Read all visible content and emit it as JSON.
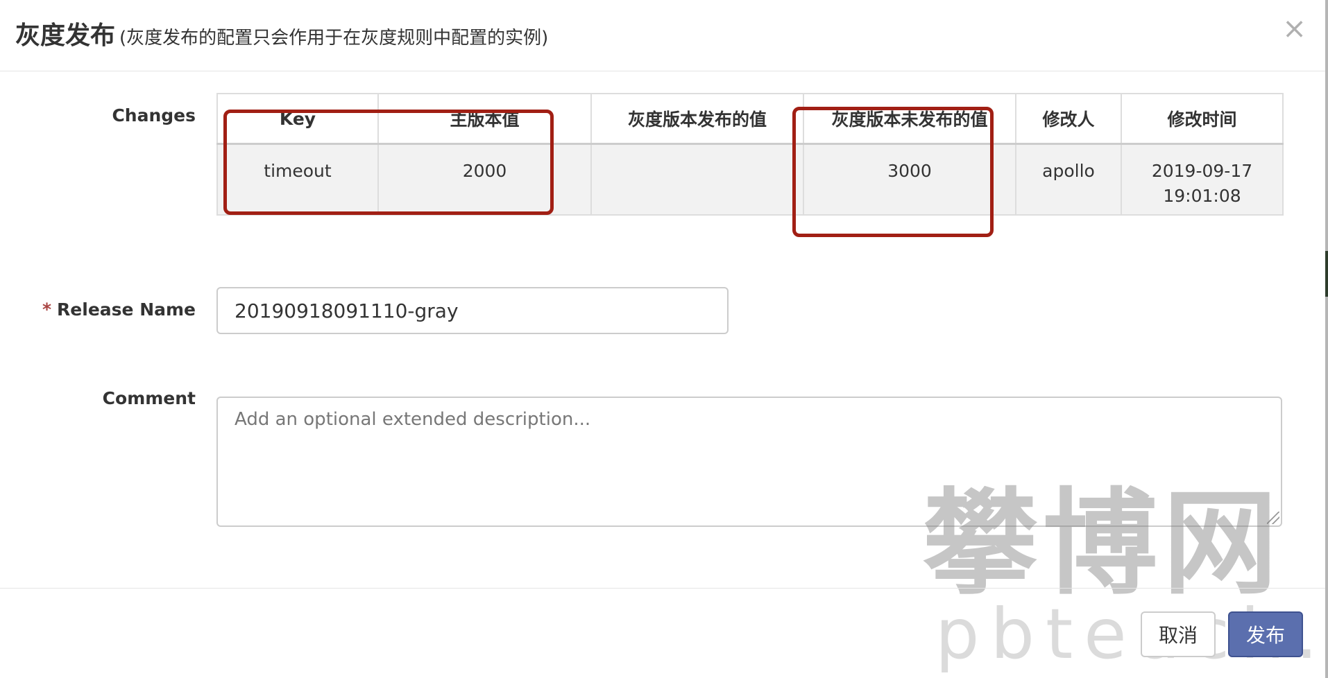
{
  "modal": {
    "title": "灰度发布",
    "subtitle": "(灰度发布的配置只会作用于在灰度规则中配置的实例)",
    "close_symbol": "×"
  },
  "form": {
    "changes_label": "Changes",
    "release_name_required_mark": "*",
    "release_name_label": "Release Name",
    "release_name_value": "20190918091110-gray",
    "comment_label": "Comment",
    "comment_placeholder": "Add an optional extended description..."
  },
  "changes_table": {
    "headers": [
      "Key",
      "主版本值",
      "灰度版本发布的值",
      "灰度版本未发布的值",
      "修改人",
      "修改时间"
    ],
    "rows": [
      [
        "timeout",
        "2000",
        "",
        "3000",
        "apollo",
        "2019-09-17 19:01:08"
      ]
    ]
  },
  "footer": {
    "cancel_label": "取消",
    "publish_label": "发布"
  },
  "watermark": {
    "cn": "攀博网",
    "en": "pbteach.com"
  },
  "colors": {
    "highlight": "#a11f14",
    "primary_button": "#5b6fae",
    "required": "#a94442"
  }
}
